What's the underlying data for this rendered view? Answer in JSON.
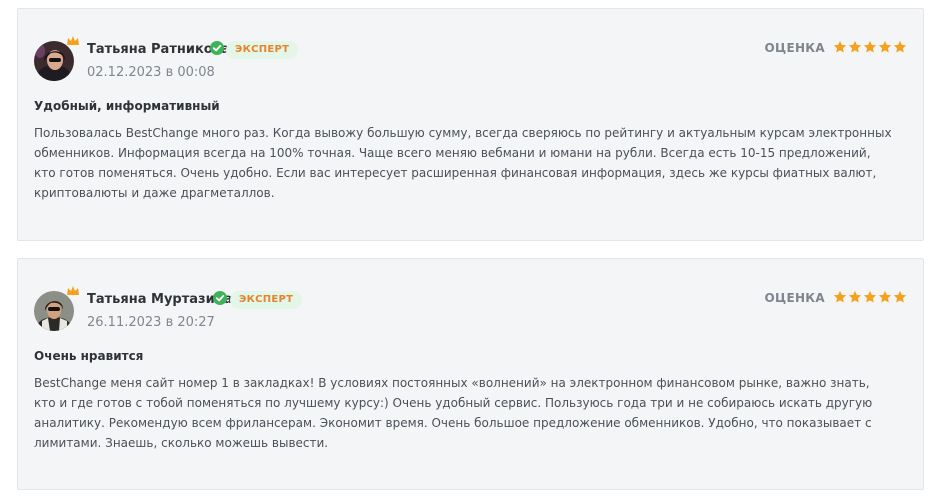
{
  "reviews": [
    {
      "author": "Татьяна Ратникова",
      "badge": "ЭКСПЕРТ",
      "date": "02.12.2023 в 00:08",
      "rating_label": "ОЦЕНКА",
      "rating": 5,
      "title": "Удобный, информативный",
      "text": "Пользовалась BestChange много раз. Когда вывожу большую сумму, всегда сверяюсь по рейтингу и актуальным курсам электронных обменников. Информация всегда на 100% точная. Чаще всего меняю вебмани и юмани на рубли. Всегда есть 10-15 предложений, кто готов поменяться. Очень удобно. Если вас интересует расширенная финансовая информация, здесь же курсы фиатных валют, криптовалюты и даже драгметаллов."
    },
    {
      "author": "Татьяна Муртазина",
      "badge": "ЭКСПЕРТ",
      "date": "26.11.2023 в 20:27",
      "rating_label": "ОЦЕНКА",
      "rating": 5,
      "title": "Очень нравится",
      "text": "BestChange меня сайт номер 1 в закладках! В условиях постоянных «волнений» на электронном финансовом рынке, важно знать, кто и где готов с тобой поменяться по лучшему курсу:) Очень удобный сервис. Пользуюсь года три и не собираюсь искать другую аналитику. Рекомендую всем фрилансерам. Экономит время. Очень большое предложение обменников. Удобно, что показывает с лимитами. Знаешь, сколько можешь вывести."
    }
  ],
  "colors": {
    "star": "#f4a21d",
    "badge_bg": "#e3f6e7",
    "badge_text": "#e6832c",
    "verified": "#3fb35a",
    "card_bg": "#f4f5f7"
  },
  "icons": {
    "avatar": "avatar",
    "crown": "crown-icon",
    "verified": "verified-check-icon",
    "star": "star-icon"
  }
}
